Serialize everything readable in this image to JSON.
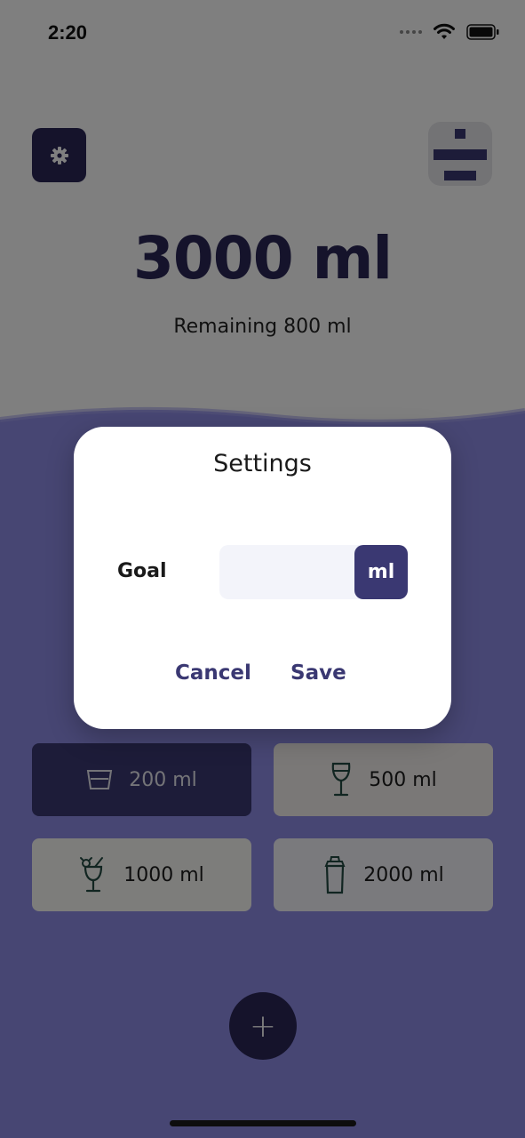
{
  "status_bar": {
    "time": "2:20",
    "icons": [
      "signal-dots-icon",
      "wifi-icon",
      "battery-icon"
    ]
  },
  "header": {
    "settings_icon": "gear-icon",
    "logo_icon": "divide-logo-icon"
  },
  "summary": {
    "goal_amount": "3000 ml",
    "remaining": "Remaining 800 ml"
  },
  "drinks": [
    {
      "label": "200 ml",
      "icon": "glass-icon",
      "selected": true
    },
    {
      "label": "500 ml",
      "icon": "wine-glass-icon",
      "selected": false
    },
    {
      "label": "1000 ml",
      "icon": "cocktail-icon",
      "selected": false
    },
    {
      "label": "2000 ml",
      "icon": "shaker-icon",
      "selected": false
    }
  ],
  "add_button": {
    "symbol": "+",
    "icon": "plus-icon"
  },
  "dialog": {
    "title": "Settings",
    "goal_label": "Goal",
    "goal_value": "",
    "goal_placeholder": "",
    "unit_label": "ml",
    "cancel_label": "Cancel",
    "save_label": "Save"
  },
  "colors": {
    "accent": "#3a3872",
    "accent_dark": "#2a2757",
    "water": "#8a87e0",
    "input_bg": "#f3f4fa"
  }
}
